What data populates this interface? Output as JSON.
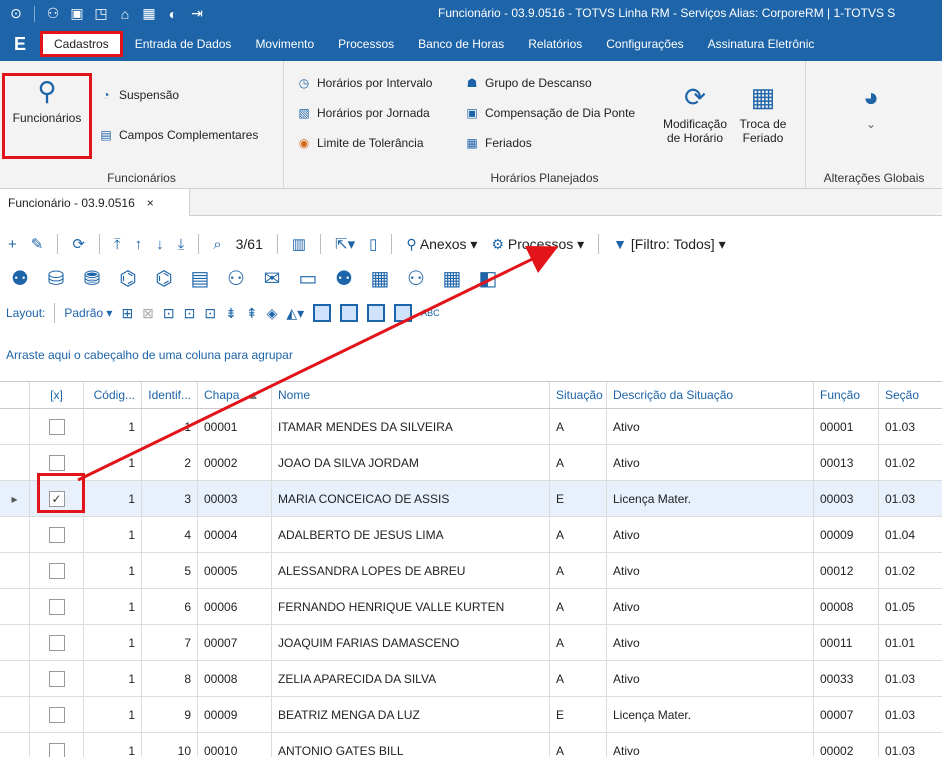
{
  "window": {
    "title": "Funcionário - 03.9.0516 - TOTVS Linha RM - Serviços  Alias: CorporeRM | 1-TOTVS S"
  },
  "menubar": {
    "app_glyph": "E",
    "items": [
      {
        "label": "Cadastros"
      },
      {
        "label": "Entrada de Dados"
      },
      {
        "label": "Movimento"
      },
      {
        "label": "Processos"
      },
      {
        "label": "Banco de Horas"
      },
      {
        "label": "Relatórios"
      },
      {
        "label": "Configurações"
      },
      {
        "label": "Assinatura Eletrônic"
      }
    ]
  },
  "ribbon": {
    "funcionarios_group": {
      "label": "Funcionários",
      "big_button": "Funcionários",
      "suspensao": "Suspensão",
      "campos": "Campos Complementares"
    },
    "horarios_group": {
      "label": "Horários Planejados",
      "intervalo": "Horários por Intervalo",
      "jornada": "Horários por Jornada",
      "tolerancia": "Limite de Tolerância",
      "descanso": "Grupo de Descanso",
      "ponte": "Compensação de Dia Ponte",
      "feriados": "Feriados",
      "modificacao_1": "Modificação",
      "modificacao_2": "de Horário",
      "troca_1": "Troca de",
      "troca_2": "Feriado"
    },
    "globais_group": {
      "label": "Alterações Globais"
    }
  },
  "doc_tab": {
    "label": "Funcionário - 03.9.0516",
    "close": "×"
  },
  "toolbar": {
    "record_pos": "3/61",
    "anexos": "Anexos",
    "processos": "Processos",
    "filtro": "[Filtro: Todos]"
  },
  "layout_bar": {
    "label": "Layout:",
    "preset": "Padrão"
  },
  "group_hint": "Arraste aqui o cabeçalho de uma coluna para agrupar",
  "grid": {
    "headers": [
      "[x]",
      "Códig...",
      "Identif...",
      "Chapa",
      "Nome",
      "Situação",
      "Descrição da Situação",
      "Função",
      "Seção"
    ],
    "rows": [
      {
        "checked": false,
        "codigo": "1",
        "ident": "1",
        "chapa": "00001",
        "nome": "ITAMAR MENDES DA SILVEIRA",
        "sit": "A",
        "desc": "Ativo",
        "funcao": "00001",
        "secao": "01.03"
      },
      {
        "checked": false,
        "codigo": "1",
        "ident": "2",
        "chapa": "00002",
        "nome": "JOAO DA SILVA JORDAM",
        "sit": "A",
        "desc": "Ativo",
        "funcao": "00013",
        "secao": "01.02"
      },
      {
        "checked": true,
        "codigo": "1",
        "ident": "3",
        "chapa": "00003",
        "nome": "MARIA CONCEICAO DE ASSIS",
        "sit": "E",
        "desc": "Licença Mater.",
        "funcao": "00003",
        "secao": "01.03"
      },
      {
        "checked": false,
        "codigo": "1",
        "ident": "4",
        "chapa": "00004",
        "nome": "ADALBERTO DE JESUS LIMA",
        "sit": "A",
        "desc": "Ativo",
        "funcao": "00009",
        "secao": "01.04"
      },
      {
        "checked": false,
        "codigo": "1",
        "ident": "5",
        "chapa": "00005",
        "nome": "ALESSANDRA LOPES DE ABREU",
        "sit": "A",
        "desc": "Ativo",
        "funcao": "00012",
        "secao": "01.02"
      },
      {
        "checked": false,
        "codigo": "1",
        "ident": "6",
        "chapa": "00006",
        "nome": "FERNANDO HENRIQUE VALLE KURTEN",
        "sit": "A",
        "desc": "Ativo",
        "funcao": "00008",
        "secao": "01.05"
      },
      {
        "checked": false,
        "codigo": "1",
        "ident": "7",
        "chapa": "00007",
        "nome": "JOAQUIM FARIAS DAMASCENO",
        "sit": "A",
        "desc": "Ativo",
        "funcao": "00011",
        "secao": "01.01"
      },
      {
        "checked": false,
        "codigo": "1",
        "ident": "8",
        "chapa": "00008",
        "nome": "ZELIA APARECIDA DA SILVA",
        "sit": "A",
        "desc": "Ativo",
        "funcao": "00033",
        "secao": "01.03"
      },
      {
        "checked": false,
        "codigo": "1",
        "ident": "9",
        "chapa": "00009",
        "nome": "BEATRIZ MENGA DA LUZ",
        "sit": "E",
        "desc": "Licença Mater.",
        "funcao": "00007",
        "secao": "01.03"
      },
      {
        "checked": false,
        "codigo": "1",
        "ident": "10",
        "chapa": "00010",
        "nome": "ANTONIO GATES BILL",
        "sit": "A",
        "desc": "Ativo",
        "funcao": "00002",
        "secao": "01.03"
      }
    ]
  },
  "colors": {
    "brand": "#1d64a8",
    "highlight": "#e2141a"
  }
}
